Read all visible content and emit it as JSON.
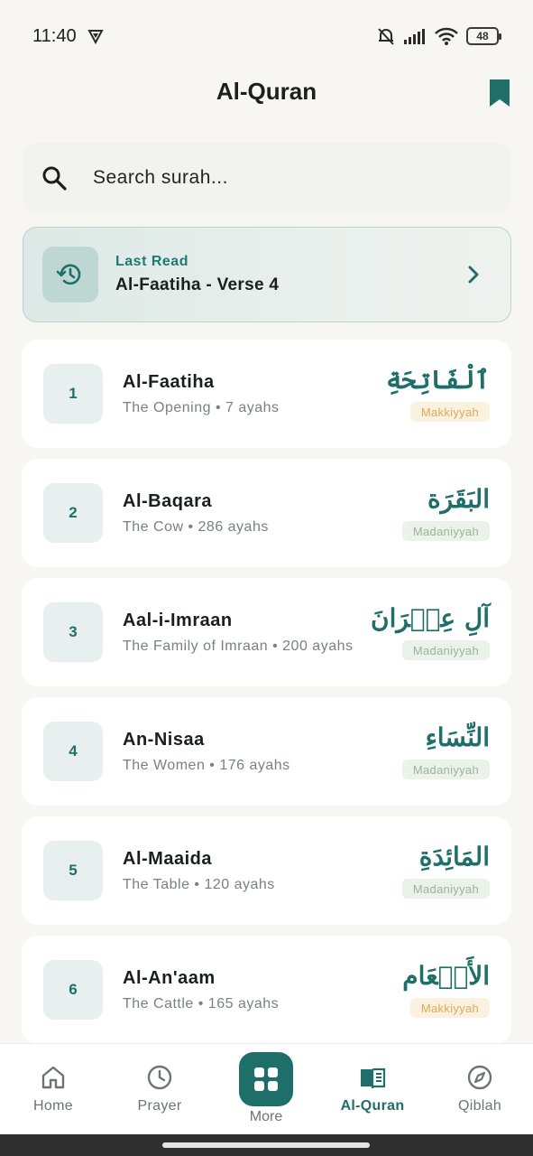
{
  "status_bar": {
    "time": "11:40",
    "battery": "48"
  },
  "header": {
    "title": "Al-Quran"
  },
  "search": {
    "placeholder": "Search surah..."
  },
  "last_read": {
    "label": "Last Read",
    "value": "Al-Faatiha - Verse 4"
  },
  "surahs": [
    {
      "number": "1",
      "name": "Al-Faatiha",
      "subtitle": "The Opening • 7 ayahs",
      "arabic": "ٱلْفَاتِحَةِ",
      "type": "Makkiyyah"
    },
    {
      "number": "2",
      "name": "Al-Baqara",
      "subtitle": "The Cow • 286 ayahs",
      "arabic": "البَقَرَة",
      "type": "Madaniyyah"
    },
    {
      "number": "3",
      "name": "Aal-i-Imraan",
      "subtitle": "The Family of Imraan • 200 ayahs",
      "arabic": "آلِ عِمۡرَانَ",
      "type": "Madaniyyah"
    },
    {
      "number": "4",
      "name": "An-Nisaa",
      "subtitle": "The Women • 176 ayahs",
      "arabic": "النِّسَاءِ",
      "type": "Madaniyyah"
    },
    {
      "number": "5",
      "name": "Al-Maaida",
      "subtitle": "The Table • 120 ayahs",
      "arabic": "المَائِدَةِ",
      "type": "Madaniyyah"
    },
    {
      "number": "6",
      "name": "Al-An'aam",
      "subtitle": "The Cattle • 165 ayahs",
      "arabic": "الأَنۡعَام",
      "type": "Makkiyyah"
    }
  ],
  "nav": {
    "home": "Home",
    "prayer": "Prayer",
    "more": "More",
    "quran": "Al-Quran",
    "qiblah": "Qiblah"
  },
  "colors": {
    "accent": "#1e6f69",
    "makki_badge": "#dfa95a",
    "madani_badge": "#9bb39b",
    "background": "#f8f6f2"
  }
}
